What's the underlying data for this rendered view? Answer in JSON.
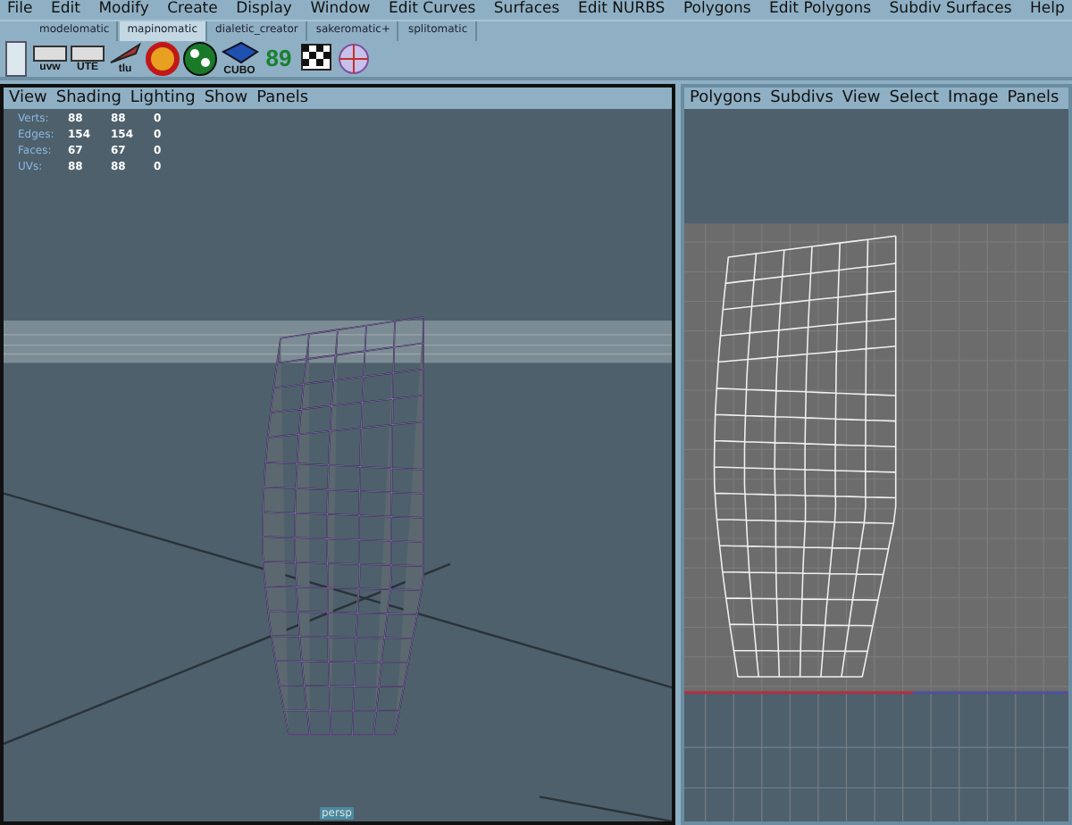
{
  "menu_bar": [
    "File",
    "Edit",
    "Modify",
    "Create",
    "Display",
    "Window",
    "Edit Curves",
    "Surfaces",
    "Edit NURBS",
    "Polygons",
    "Edit Polygons",
    "Subdiv Surfaces",
    "Help"
  ],
  "shelf_tabs": [
    {
      "label": "modelomatic",
      "selected": false
    },
    {
      "label": "mapinomatic",
      "selected": true
    },
    {
      "label": "dialetic_creator",
      "selected": false
    },
    {
      "label": "sakeromatic+",
      "selected": false
    },
    {
      "label": "splitomatic",
      "selected": false
    }
  ],
  "shelf_buttons": [
    {
      "kind": "frame",
      "label": "uvw"
    },
    {
      "kind": "frame",
      "label": "UTE"
    },
    {
      "kind": "knife",
      "label": "tlu"
    },
    {
      "kind": "cup"
    },
    {
      "kind": "ball"
    },
    {
      "kind": "cube",
      "label": "CUBO"
    },
    {
      "kind": "digits",
      "label": "89"
    },
    {
      "kind": "flag"
    },
    {
      "kind": "globe"
    }
  ],
  "perspective_panel": {
    "menu": [
      "View",
      "Shading",
      "Lighting",
      "Show",
      "Panels"
    ],
    "stats": [
      {
        "label": "Verts:",
        "values": [
          "88",
          "88",
          "0"
        ]
      },
      {
        "label": "Edges:",
        "values": [
          "154",
          "154",
          "0"
        ]
      },
      {
        "label": "Faces:",
        "values": [
          "67",
          "67",
          "0"
        ]
      },
      {
        "label": "UVs:",
        "values": [
          "88",
          "88",
          "0"
        ]
      }
    ],
    "camera": "persp"
  },
  "uv_panel": {
    "menu": [
      "Polygons",
      "Subdivs",
      "View",
      "Select",
      "Image",
      "Panels"
    ]
  }
}
